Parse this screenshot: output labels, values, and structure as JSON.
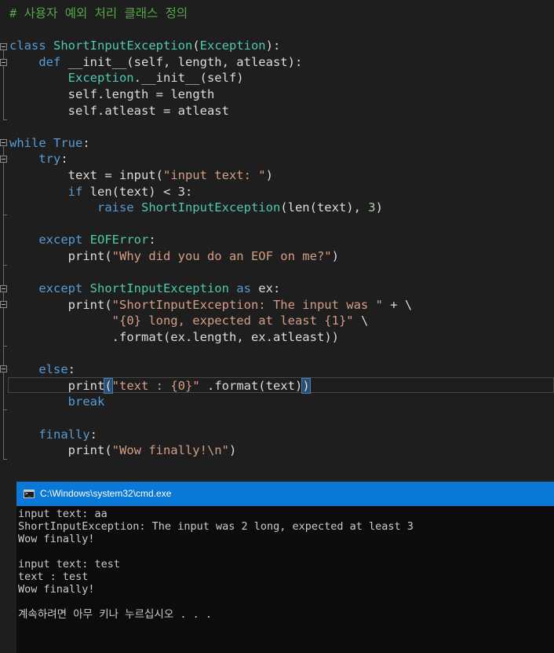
{
  "editor": {
    "lines": [
      [
        {
          "c": "cm",
          "t": "# 사용자 예외 처리 클래스 정의"
        }
      ],
      [],
      [
        {
          "c": "kw",
          "t": "class "
        },
        {
          "c": "cls",
          "t": "ShortInputException"
        },
        {
          "c": "br",
          "t": "("
        },
        {
          "c": "cls",
          "t": "Exception"
        },
        {
          "c": "br",
          "t": "):"
        }
      ],
      [
        {
          "c": "sp",
          "t": "    "
        },
        {
          "c": "kw",
          "t": "def "
        },
        {
          "c": "id",
          "t": "__init__(self, length, atleast):"
        }
      ],
      [
        {
          "c": "sp",
          "t": "        "
        },
        {
          "c": "cls",
          "t": "Exception"
        },
        {
          "c": "id",
          "t": ".__init__(self)"
        }
      ],
      [
        {
          "c": "sp",
          "t": "        "
        },
        {
          "c": "id",
          "t": "self."
        },
        {
          "c": "mbr",
          "t": "length"
        },
        {
          "c": "id",
          "t": " = length"
        }
      ],
      [
        {
          "c": "sp",
          "t": "        "
        },
        {
          "c": "id",
          "t": "self."
        },
        {
          "c": "mbr",
          "t": "atleast"
        },
        {
          "c": "id",
          "t": " = atleast"
        }
      ],
      [],
      [
        {
          "c": "kw",
          "t": "while "
        },
        {
          "c": "kw",
          "t": "True"
        },
        {
          "c": "op",
          "t": ":"
        }
      ],
      [
        {
          "c": "sp",
          "t": "    "
        },
        {
          "c": "kw",
          "t": "try"
        },
        {
          "c": "op",
          "t": ":"
        }
      ],
      [
        {
          "c": "sp",
          "t": "        "
        },
        {
          "c": "id",
          "t": "text = input("
        },
        {
          "c": "str",
          "t": "\"input text: \""
        },
        {
          "c": "id",
          "t": ")"
        }
      ],
      [
        {
          "c": "sp",
          "t": "        "
        },
        {
          "c": "kw",
          "t": "if "
        },
        {
          "c": "id",
          "t": "len(text) < 3:"
        }
      ],
      [
        {
          "c": "sp",
          "t": "            "
        },
        {
          "c": "kw",
          "t": "raise "
        },
        {
          "c": "cls",
          "t": "ShortInputException"
        },
        {
          "c": "id",
          "t": "(len(text), "
        },
        {
          "c": "num",
          "t": "3"
        },
        {
          "c": "id",
          "t": ")"
        }
      ],
      [],
      [
        {
          "c": "sp",
          "t": "    "
        },
        {
          "c": "kw",
          "t": "except "
        },
        {
          "c": "cls",
          "t": "EOFError"
        },
        {
          "c": "op",
          "t": ":"
        }
      ],
      [
        {
          "c": "sp",
          "t": "        "
        },
        {
          "c": "id",
          "t": "print("
        },
        {
          "c": "str",
          "t": "\"Why did you do an EOF on me?\""
        },
        {
          "c": "id",
          "t": ")"
        }
      ],
      [],
      [
        {
          "c": "sp",
          "t": "    "
        },
        {
          "c": "kw",
          "t": "except "
        },
        {
          "c": "cls",
          "t": "ShortInputException"
        },
        {
          "c": "kw",
          "t": " as "
        },
        {
          "c": "id",
          "t": "ex:"
        }
      ],
      [
        {
          "c": "sp",
          "t": "        "
        },
        {
          "c": "id",
          "t": "print("
        },
        {
          "c": "str",
          "t": "\"ShortInputException: The input was \""
        },
        {
          "c": "id",
          "t": " + \\"
        }
      ],
      [
        {
          "c": "sp",
          "t": "              "
        },
        {
          "c": "str",
          "t": "\"{0} long, expected at least {1}\""
        },
        {
          "c": "id",
          "t": " \\"
        }
      ],
      [
        {
          "c": "sp",
          "t": "              "
        },
        {
          "c": "id",
          "t": ".format(ex."
        },
        {
          "c": "mbr",
          "t": "length"
        },
        {
          "c": "id",
          "t": ", ex."
        },
        {
          "c": "mbr",
          "t": "atleast"
        },
        {
          "c": "id",
          "t": "))"
        }
      ],
      [],
      [
        {
          "c": "sp",
          "t": "    "
        },
        {
          "c": "kw",
          "t": "else"
        },
        {
          "c": "op",
          "t": ":"
        }
      ],
      [
        {
          "c": "sp",
          "t": "        "
        },
        {
          "c": "id",
          "t": "print"
        },
        {
          "c": "hl",
          "t": "("
        },
        {
          "c": "str",
          "t": "\"text : {0}\""
        },
        {
          "c": "id",
          "t": " .format(text)"
        },
        {
          "c": "hl",
          "t": ")"
        }
      ],
      [
        {
          "c": "sp",
          "t": "        "
        },
        {
          "c": "kw",
          "t": "break"
        }
      ],
      [],
      [
        {
          "c": "sp",
          "t": "    "
        },
        {
          "c": "kw",
          "t": "finally"
        },
        {
          "c": "op",
          "t": ":"
        }
      ],
      [
        {
          "c": "sp",
          "t": "        "
        },
        {
          "c": "id",
          "t": "print("
        },
        {
          "c": "str",
          "t": "\"Wow finally!\\n\""
        },
        {
          "c": "id",
          "t": ")"
        }
      ]
    ]
  },
  "console": {
    "title": "C:\\Windows\\system32\\cmd.exe",
    "lines": [
      "input text: aa",
      "ShortInputException: The input was 2 long, expected at least 3",
      "Wow finally!",
      "",
      "input text: test",
      "text : test",
      "Wow finally!",
      "",
      "계속하려면 아무 키나 누르십시오 . . ."
    ]
  },
  "colors": {
    "editor_bg": "#1e1e1e",
    "comment": "#57a64a",
    "keyword": "#569cd6",
    "class_name": "#4ec9b0",
    "string": "#d69d85",
    "number": "#b5cea8",
    "console_title_bg": "#0a78d7",
    "console_bg": "#0c0c0c"
  }
}
